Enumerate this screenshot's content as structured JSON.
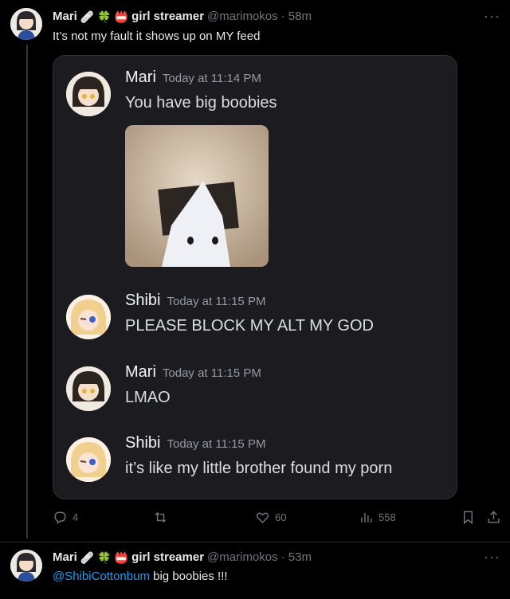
{
  "tweet1": {
    "author_name": "Mari",
    "badge_emojis": [
      "🩹",
      "🍀",
      "📛"
    ],
    "author_suffix": "girl streamer",
    "handle": "@marimokos",
    "time": "· 58m",
    "text": "It’s not my fault it shows up on MY feed",
    "more": "···",
    "embed": {
      "messages": [
        {
          "name": "Mari",
          "time": "Today at 11:14 PM",
          "text": "You have big boobies"
        },
        {
          "name": "Shibi",
          "time": "Today at 11:15 PM",
          "text": "PLEASE BLOCK MY ALT MY GOD"
        },
        {
          "name": "Mari",
          "time": "Today at 11:15 PM",
          "text": "LMAO"
        },
        {
          "name": "Shibi",
          "time": "Today at 11:15 PM",
          "text": "it’s like my little brother found my porn"
        }
      ]
    },
    "actions": {
      "replies": "4",
      "retweets": "",
      "likes": "60",
      "views": "558"
    }
  },
  "tweet2": {
    "author_name": "Mari",
    "author_suffix": "girl streamer",
    "handle": "@marimokos",
    "time": "· 53m",
    "mention": "@ShibiCottonbum",
    "text": " big boobies !!!",
    "more": "···"
  },
  "colors": {
    "accent": "#1d9bf0",
    "muted": "#71767b",
    "embed_bg": "#1c1c20"
  }
}
